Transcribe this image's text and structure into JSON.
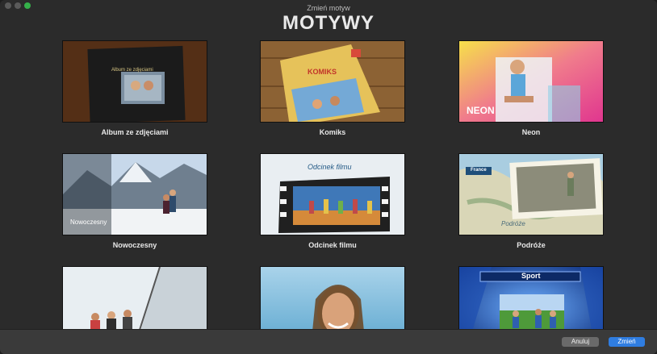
{
  "window": {
    "title": "Zmień motyw"
  },
  "heading": "MOTYWY",
  "themes": [
    {
      "label": "Album ze zdjęciami",
      "overlay": "Album ze zdjęciami"
    },
    {
      "label": "Komiks",
      "overlay": "KOMIKS"
    },
    {
      "label": "Neon",
      "overlay": "NEON"
    },
    {
      "label": "Nowoczesny",
      "overlay": "Nowoczesny"
    },
    {
      "label": "Odcinek filmu",
      "overlay": "Odcinek filmu"
    },
    {
      "label": "Podróże",
      "overlay": "Podróże",
      "overlay2": "France"
    },
    {
      "label": "",
      "overlay": ""
    },
    {
      "label": "",
      "overlay": ""
    },
    {
      "label": "",
      "overlay": "Sport"
    }
  ],
  "buttons": {
    "cancel": "Anuluj",
    "confirm": "Zmień"
  }
}
